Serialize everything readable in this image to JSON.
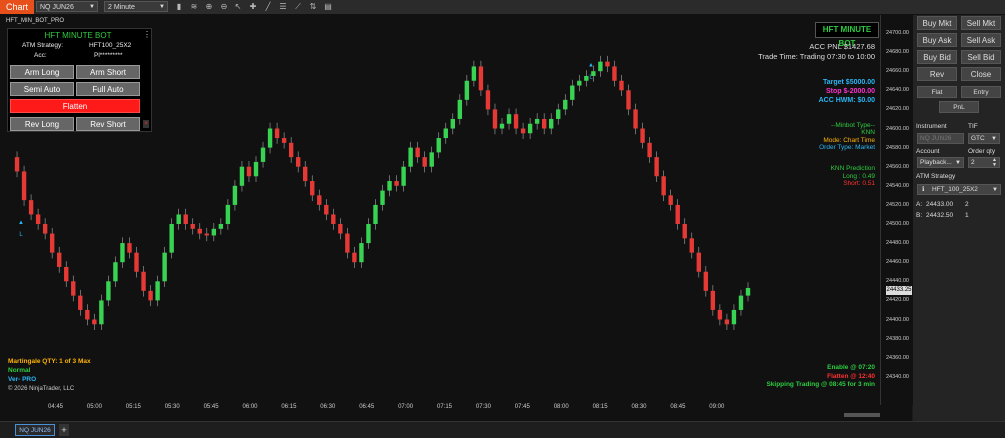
{
  "toolbar": {
    "chart_tab": "Chart",
    "instrument": "NQ JUN26",
    "timeframe": "2 Minute"
  },
  "chart": {
    "title": "HFT_MIN_BOT_PRO",
    "copyright": "© 2026 NinjaTrader, LLC",
    "current_price": "24433.25",
    "y_ticks": [
      "24700.00",
      "24680.00",
      "24660.00",
      "24640.00",
      "24620.00",
      "24600.00",
      "24580.00",
      "24560.00",
      "24540.00",
      "24520.00",
      "24500.00",
      "24480.00",
      "24460.00",
      "24440.00",
      "24420.00",
      "24400.00",
      "24380.00",
      "24360.00",
      "24340.00"
    ],
    "x_ticks": [
      "04:45",
      "05:00",
      "05:15",
      "05:30",
      "05:45",
      "06:00",
      "06:15",
      "06:30",
      "06:45",
      "07:00",
      "07:15",
      "07:30",
      "07:45",
      "08:00",
      "08:15",
      "08:30",
      "08:45",
      "09:00"
    ],
    "markers": [
      {
        "label": "L"
      },
      {
        "label": "L"
      }
    ]
  },
  "bot_panel": {
    "title": "HFT MINUTE BOT",
    "atm_label": "ATM Strategy:",
    "atm_value": "HFT100_25X2",
    "acc_label": "Acc:",
    "acc_value": "Pl*********",
    "arm_long": "Arm Long",
    "arm_short": "Arm Short",
    "semi_auto": "Semi Auto",
    "full_auto": "Full Auto",
    "flatten": "Flatten",
    "rev_long": "Rev Long",
    "rev_short": "Rev Short"
  },
  "overlay": {
    "badge": "HFT MINUTE BOT",
    "acc_pnl": "ACC PNL $1427.68",
    "trade_time": "Trade Time: Trading 07:30 to 10:00",
    "target": "Target $5000.00",
    "stop": "Stop $-2000.00",
    "acc_hwm": "ACC HWM: $0.00",
    "minibot_type": "--Minbot Type--",
    "knn": "KNN",
    "mode": "Mode: Chart Time",
    "order_type": "Order Type: Market",
    "knn_prediction": "KNN Prediction",
    "long": "Long : 0.49",
    "short": "Short: 0.51",
    "martingale": "Martingale  QTY: 1 of 3 Max",
    "normal": "Normal",
    "ver": "Ver- PRO",
    "enable": "Enable @ 07:20",
    "flatten_at": "Flatten @ 12:40",
    "skipping": "Skipping Trading @ 08:45 for 3 min"
  },
  "colors": {
    "up": "#39d353",
    "down": "#e53935",
    "accent": "#e8501b",
    "green_text": "#2ecc40",
    "blue_text": "#29b6f6",
    "magenta_text": "#ff2fd0",
    "orange_text": "#ffb300",
    "red_text": "#ff3030"
  },
  "right_panel": {
    "buy_mkt": "Buy Mkt",
    "sell_mkt": "Sell Mkt",
    "buy_ask": "Buy Ask",
    "sell_ask": "Sell Ask",
    "buy_bid": "Buy Bid",
    "sell_bid": "Sell Bid",
    "rev": "Rev",
    "close": "Close",
    "flat": "Flat",
    "entry": "Entry",
    "pnl": "PnL",
    "instrument_label": "Instrument",
    "tif_label": "TIF",
    "instrument_value": "NQ JUN26",
    "tif_value": "GTC",
    "account_label": "Account",
    "order_qty_label": "Order qty",
    "account_value": "Playback...",
    "order_qty_value": "2",
    "atm_label": "ATM Strategy",
    "atm_value": "HFT_100_25X2",
    "a_label": "A:",
    "a_price": "24433.00",
    "a_qty": "2",
    "b_label": "B:",
    "b_price": "24432.50",
    "b_qty": "1"
  },
  "bottom": {
    "tab": "NQ JUN26",
    "add": "+"
  }
}
